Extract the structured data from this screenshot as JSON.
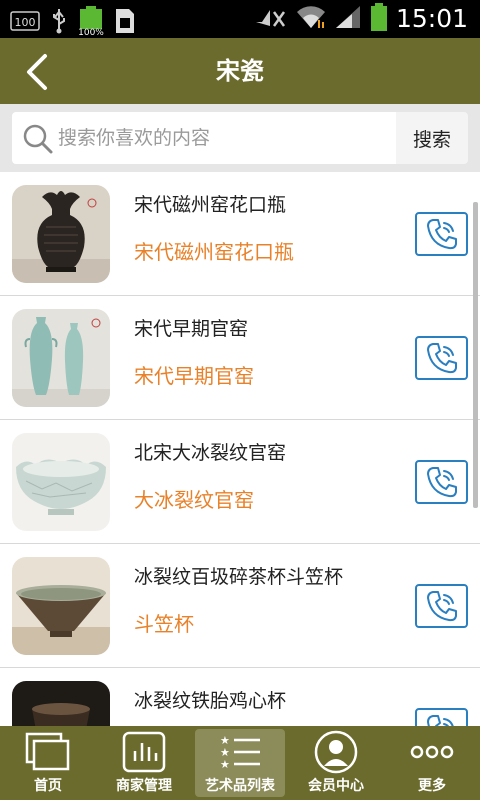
{
  "status_bar": {
    "time": "15:01",
    "notification_badge": "100",
    "battery_percent": "100%",
    "icons": [
      "notification-100-icon",
      "usb-icon",
      "battery-100-icon",
      "screenshot-icon",
      "mute-icon",
      "wifi-icon",
      "signal-icon",
      "battery-icon"
    ]
  },
  "header": {
    "title": "宋瓷",
    "back_icon": "chevron-left-icon"
  },
  "search": {
    "placeholder": "搜索你喜欢的内容",
    "button_label": "搜索"
  },
  "items": [
    {
      "title": "宋代磁州窑花口瓶",
      "subtitle": "宋代磁州窑花口瓶",
      "thumb": "black-vase"
    },
    {
      "title": "宋代早期官窑",
      "subtitle": "宋代早期官窑",
      "thumb": "celadon-vases"
    },
    {
      "title": "北宋大冰裂纹官窑",
      "subtitle": "大冰裂纹官窑",
      "thumb": "crackle-bowl"
    },
    {
      "title": "冰裂纹百圾碎茶杯斗笠杯",
      "subtitle": "斗笠杯",
      "thumb": "conical-cup"
    },
    {
      "title": "冰裂纹铁胎鸡心杯",
      "subtitle": "",
      "thumb": "dark-cup"
    }
  ],
  "bottom_nav": [
    {
      "label": "首页",
      "icon": "home-windows-icon",
      "active": false
    },
    {
      "label": "商家管理",
      "icon": "chart-box-icon",
      "active": false
    },
    {
      "label": "艺术品列表",
      "icon": "star-list-icon",
      "active": true
    },
    {
      "label": "会员中心",
      "icon": "user-circle-icon",
      "active": false
    },
    {
      "label": "更多",
      "icon": "more-dots-icon",
      "active": false
    }
  ],
  "colors": {
    "header_bg": "#6b6b2e",
    "accent_orange": "#e8822a",
    "call_blue": "#2a7fc0"
  }
}
